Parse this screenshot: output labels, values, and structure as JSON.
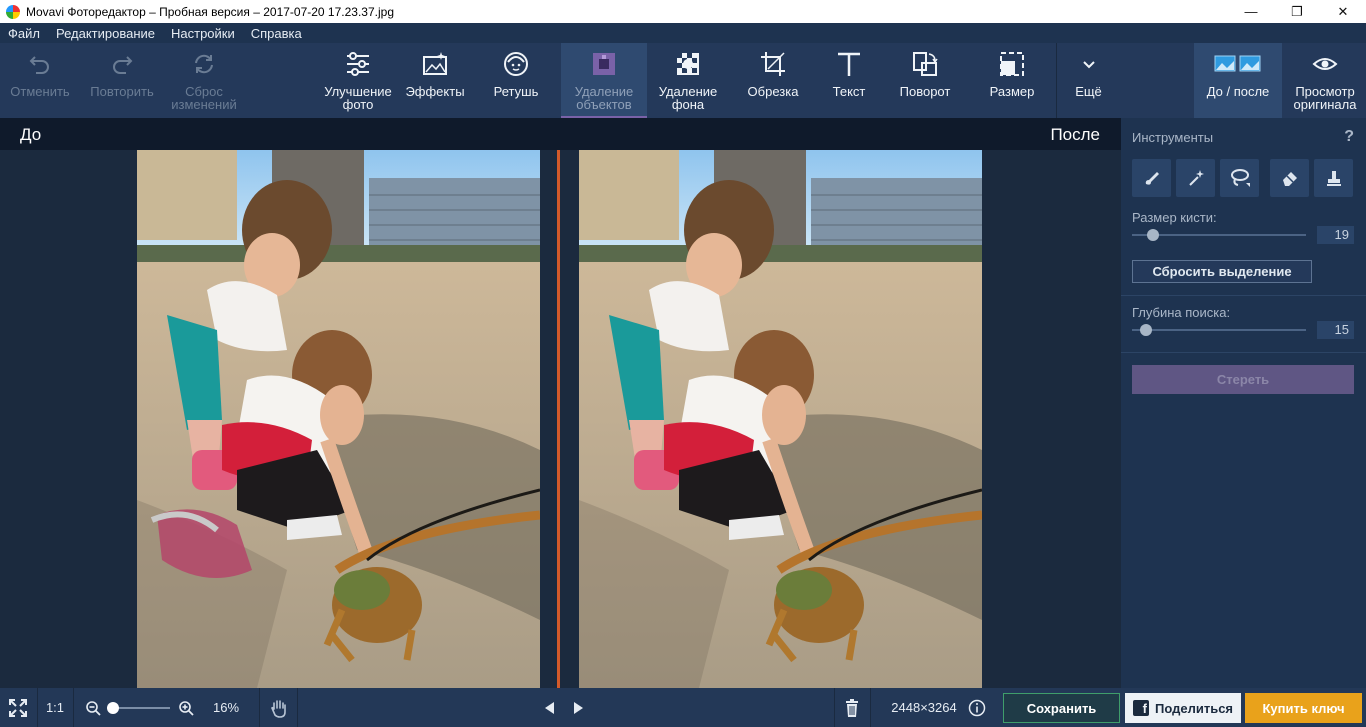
{
  "window": {
    "title": "Movavi Фоторедактор – Пробная версия – 2017-07-20 17.23.37.jpg"
  },
  "menu": [
    "Файл",
    "Редактирование",
    "Настройки",
    "Справка"
  ],
  "toolbar": {
    "undo": "Отменить",
    "redo": "Повторить",
    "reset_1": "Сброс",
    "reset_2": "изменений",
    "enhance_1": "Улучшение",
    "enhance_2": "фото",
    "effects": "Эффекты",
    "retouch": "Ретушь",
    "remove_objects_1": "Удаление",
    "remove_objects_2": "объектов",
    "remove_bg_1": "Удаление",
    "remove_bg_2": "фона",
    "crop": "Обрезка",
    "text": "Текст",
    "rotate": "Поворот",
    "resize": "Размер",
    "more": "Ещё",
    "before_after": "До / после",
    "view_original_1": "Просмотр",
    "view_original_2": "оригинала"
  },
  "canvas": {
    "before_label": "До",
    "after_label": "После"
  },
  "panel": {
    "heading": "Инструменты",
    "help": "?",
    "brush_size_label": "Размер кисти:",
    "brush_size_value": "19",
    "brush_size_fraction": 0.12,
    "reset_selection": "Сбросить выделение",
    "search_depth_label": "Глубина поиска:",
    "search_depth_value": "15",
    "search_depth_fraction": 0.08,
    "erase": "Стереть"
  },
  "bottom": {
    "ratio": "1:1",
    "zoom": "16%",
    "zoom_fraction": 0.05,
    "dimensions": "2448×3264",
    "save": "Сохранить",
    "share": "Поделиться",
    "buy": "Купить ключ"
  },
  "colors": {
    "accent_divider": "#d35a2a",
    "save_border": "#3f9e6b",
    "buy": "#e9a21b",
    "erase": "#5f5684"
  }
}
